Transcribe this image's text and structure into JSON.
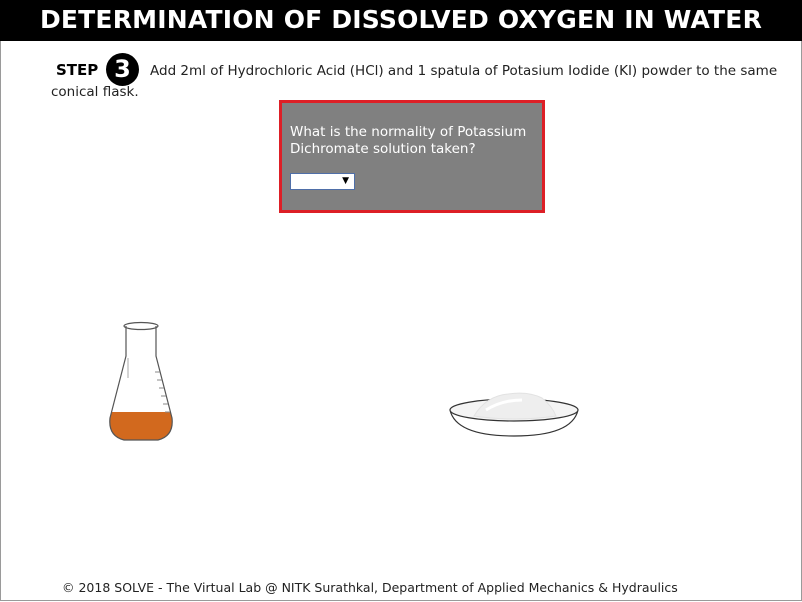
{
  "header": {
    "title": "DETERMINATION OF DISSOLVED OXYGEN IN WATER"
  },
  "step": {
    "label": "STEP",
    "number": "3",
    "instruction": "Add 2ml of Hydrochloric Acid (HCl) and 1 spatula of Potasium Iodide (KI) powder to the same conical flask."
  },
  "question": {
    "text": "What is the normality of Potassium Dichromate solution taken?",
    "dropdown": {
      "selected": "",
      "arrow": "▼"
    }
  },
  "apparatus": {
    "flask": {
      "name": "conical flask",
      "liquid_color": "#d2691e"
    },
    "dish": {
      "name": "watch glass with KI powder"
    }
  },
  "footer": {
    "copyright": "© 2018 SOLVE - The Virtual Lab @ NITK Surathkal, Department of Applied Mechanics & Hydraulics"
  },
  "colors": {
    "header_bg": "#000000",
    "question_bg": "#808080",
    "question_border": "#dd1f26"
  }
}
